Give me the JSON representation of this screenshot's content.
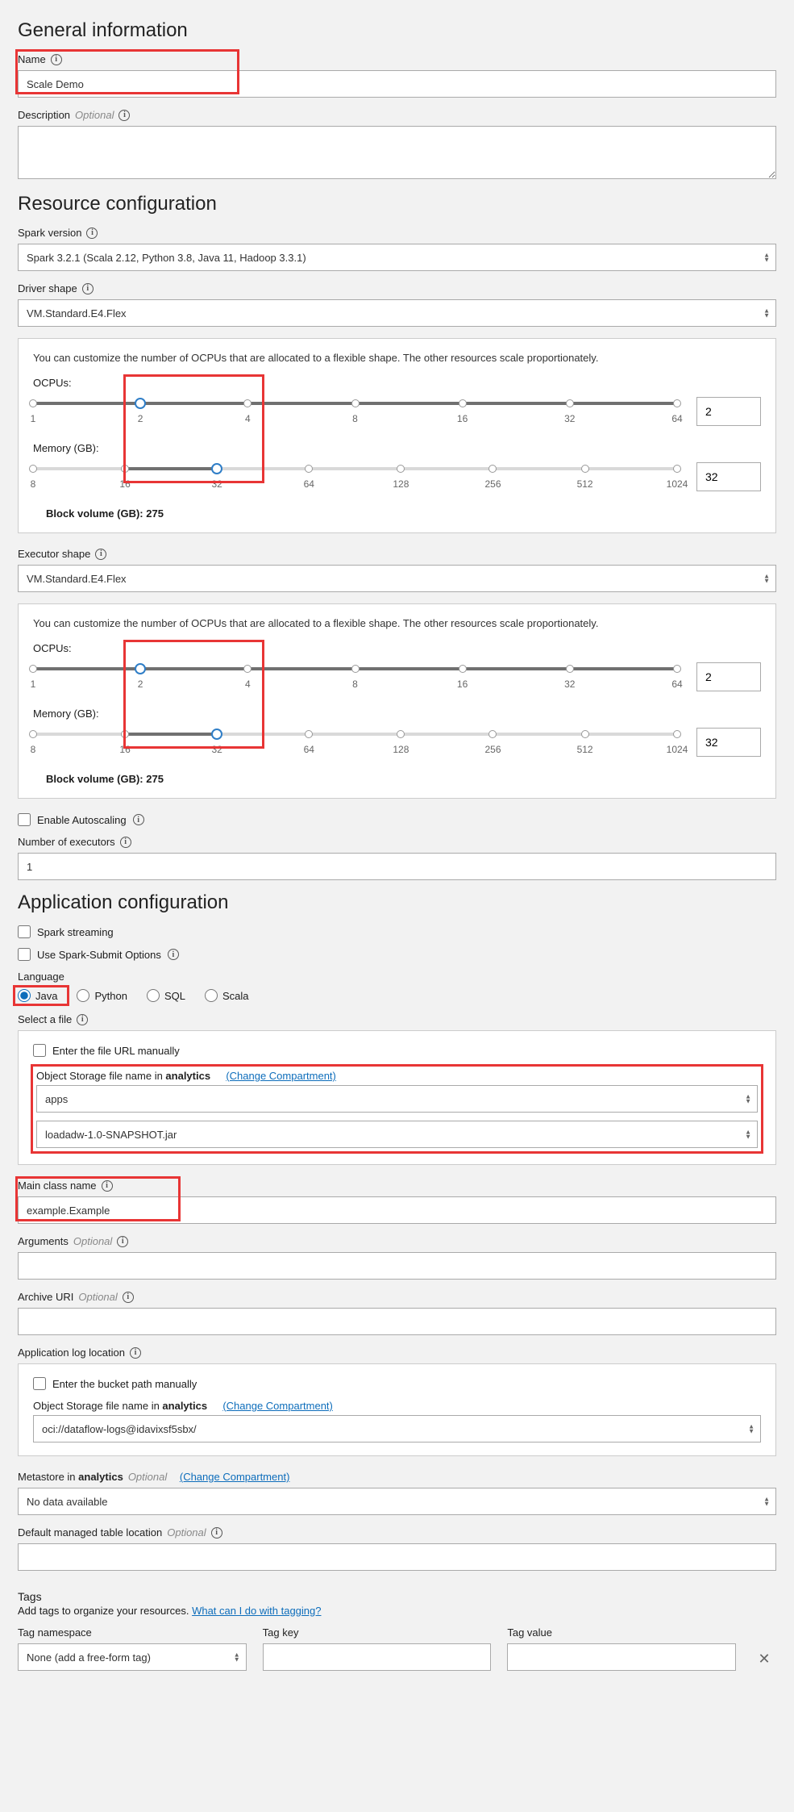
{
  "general": {
    "title": "General information",
    "name_label": "Name",
    "name_value": "Scale Demo",
    "desc_label": "Description",
    "optional": "Optional"
  },
  "resource": {
    "title": "Resource configuration",
    "spark_label": "Spark version",
    "spark_value": "Spark 3.2.1 (Scala 2.12, Python 3.8, Java 11, Hadoop 3.3.1)",
    "driver_label": "Driver shape",
    "driver_value": "VM.Standard.E4.Flex",
    "panel_desc": "You can customize the number of OCPUs that are allocated to a flexible shape. The other resources scale proportionately.",
    "ocpu_label": "OCPUs:",
    "mem_label": "Memory (GB):",
    "ocpu_ticks": [
      "1",
      "2",
      "4",
      "8",
      "16",
      "32",
      "64"
    ],
    "mem_ticks": [
      "8",
      "16",
      "32",
      "64",
      "128",
      "256",
      "512",
      "1024"
    ],
    "driver_ocpu_val": "2",
    "driver_mem_val": "32",
    "driver_block_vol": "Block volume (GB): 275",
    "exec_label": "Executor shape",
    "exec_value": "VM.Standard.E4.Flex",
    "exec_ocpu_val": "2",
    "exec_mem_val": "32",
    "exec_block_vol": "Block volume (GB): 275",
    "autoscale_label": "Enable Autoscaling",
    "num_exec_label": "Number of executors",
    "num_exec_val": "1"
  },
  "app": {
    "title": "Application configuration",
    "spark_streaming": "Spark streaming",
    "use_spark_submit": "Use Spark-Submit Options",
    "lang_label": "Language",
    "lang_java": "Java",
    "lang_python": "Python",
    "lang_sql": "SQL",
    "lang_scala": "Scala",
    "select_file_label": "Select a file",
    "enter_url_label": "Enter the file URL manually",
    "obj_storage_prefix": "Object Storage file name in ",
    "obj_storage_compartment": "analytics",
    "change_compartment": "(Change Compartment)",
    "bucket_val": "apps",
    "file_val": "loadadw-1.0-SNAPSHOT.jar",
    "main_class_label": "Main class name",
    "main_class_val": "example.Example",
    "args_label": "Arguments",
    "archive_label": "Archive URI",
    "log_loc_label": "Application log location",
    "enter_bucket_label": "Enter the bucket path manually",
    "log_bucket_val": "oci://dataflow-logs@idavixsf5sbx/",
    "metastore_label_prefix": "Metastore in ",
    "metastore_compartment": "analytics",
    "metastore_val": "No data available",
    "managed_table_label": "Default managed table location"
  },
  "tags": {
    "title": "Tags",
    "desc_prefix": "Add tags to organize your resources. ",
    "link": "What can I do with tagging?",
    "ns_label": "Tag namespace",
    "key_label": "Tag key",
    "val_label": "Tag value",
    "ns_val": "None (add a free-form tag)"
  }
}
